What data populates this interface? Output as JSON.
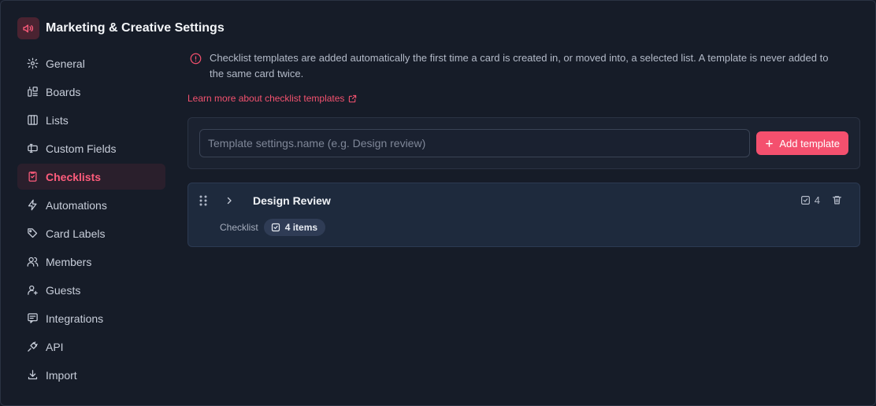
{
  "header": {
    "title": "Marketing & Creative Settings",
    "icon": "megaphone-icon"
  },
  "sidebar": {
    "items": [
      {
        "label": "General",
        "icon": "gear-icon"
      },
      {
        "label": "Boards",
        "icon": "boards-icon"
      },
      {
        "label": "Lists",
        "icon": "lists-icon"
      },
      {
        "label": "Custom Fields",
        "icon": "custom-fields-icon"
      },
      {
        "label": "Checklists",
        "icon": "checklist-icon",
        "active": true
      },
      {
        "label": "Automations",
        "icon": "lightning-icon"
      },
      {
        "label": "Card Labels",
        "icon": "tag-icon"
      },
      {
        "label": "Members",
        "icon": "users-icon"
      },
      {
        "label": "Guests",
        "icon": "user-plus-icon"
      },
      {
        "label": "Integrations",
        "icon": "integrations-icon"
      },
      {
        "label": "API",
        "icon": "plug-icon"
      },
      {
        "label": "Import",
        "icon": "download-icon"
      }
    ]
  },
  "main": {
    "info_text": "Checklist templates are added automatically the first time a card is created in, or moved into, a selected list. A template is never added to the same card twice.",
    "learn_more": "Learn more about checklist templates",
    "input_placeholder": "Template settings.name (e.g. Design review)",
    "input_value": "",
    "add_button": "Add template",
    "templates": [
      {
        "name": "Design Review",
        "count": "4",
        "type": "Checklist",
        "items_label": "4 items"
      }
    ]
  },
  "colors": {
    "accent": "#f4506e",
    "active_bg": "#2a1f2c",
    "background": "#161c28",
    "card_bg": "#1e2a3d"
  }
}
